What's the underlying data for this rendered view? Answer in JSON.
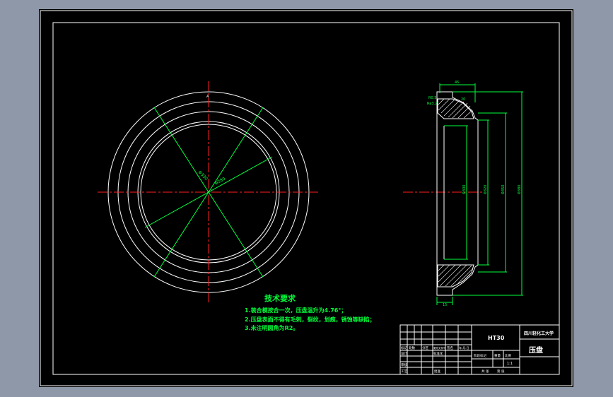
{
  "drawing": {
    "colors": {
      "background": "#8e98a8",
      "sheet": "#000000",
      "outline": "#ffffff",
      "centerline": "#ff2020",
      "dimension": "#00ff3c",
      "note_text": "#00ff3c",
      "hatch": "#ffffff"
    },
    "front_view": {
      "dim_labels": [
        "Φ330",
        "Φ280"
      ],
      "top_mark": "A"
    },
    "section_view": {
      "top_dim": "45",
      "side_dim": "20",
      "tolerance": "R0.5",
      "surface_mark": "Ra3.2",
      "bottom_dim": "15",
      "vertical_dims": [
        "Φ300",
        "Φ320",
        "Φ350",
        "Φ380"
      ]
    },
    "tech_requirements": {
      "title": "技术要求",
      "items": [
        "1.装合模按合一次，压盘温升为4.76°；",
        "2.压盘表面不得有毛刺，裂纹，划痕，锈蚀等缺陷；",
        "3.未注明圆角为R2。"
      ]
    },
    "title_block": {
      "material": "HT30",
      "school": "四川轻化工大学",
      "part_name": "压盘",
      "scale": "1:1",
      "row_labels": [
        "标记",
        "处数",
        "分区",
        "更改文件号",
        "签名",
        "年.月.日"
      ],
      "design_label": "设计",
      "standard_label": "标准化",
      "review_label": "审核",
      "process_label": "工艺",
      "approve_label": "批准",
      "stage_label": "阶段标记",
      "weight_label": "重量",
      "scale_label": "比例",
      "sheet_label": "共 张",
      "page_label": "第 张"
    }
  }
}
